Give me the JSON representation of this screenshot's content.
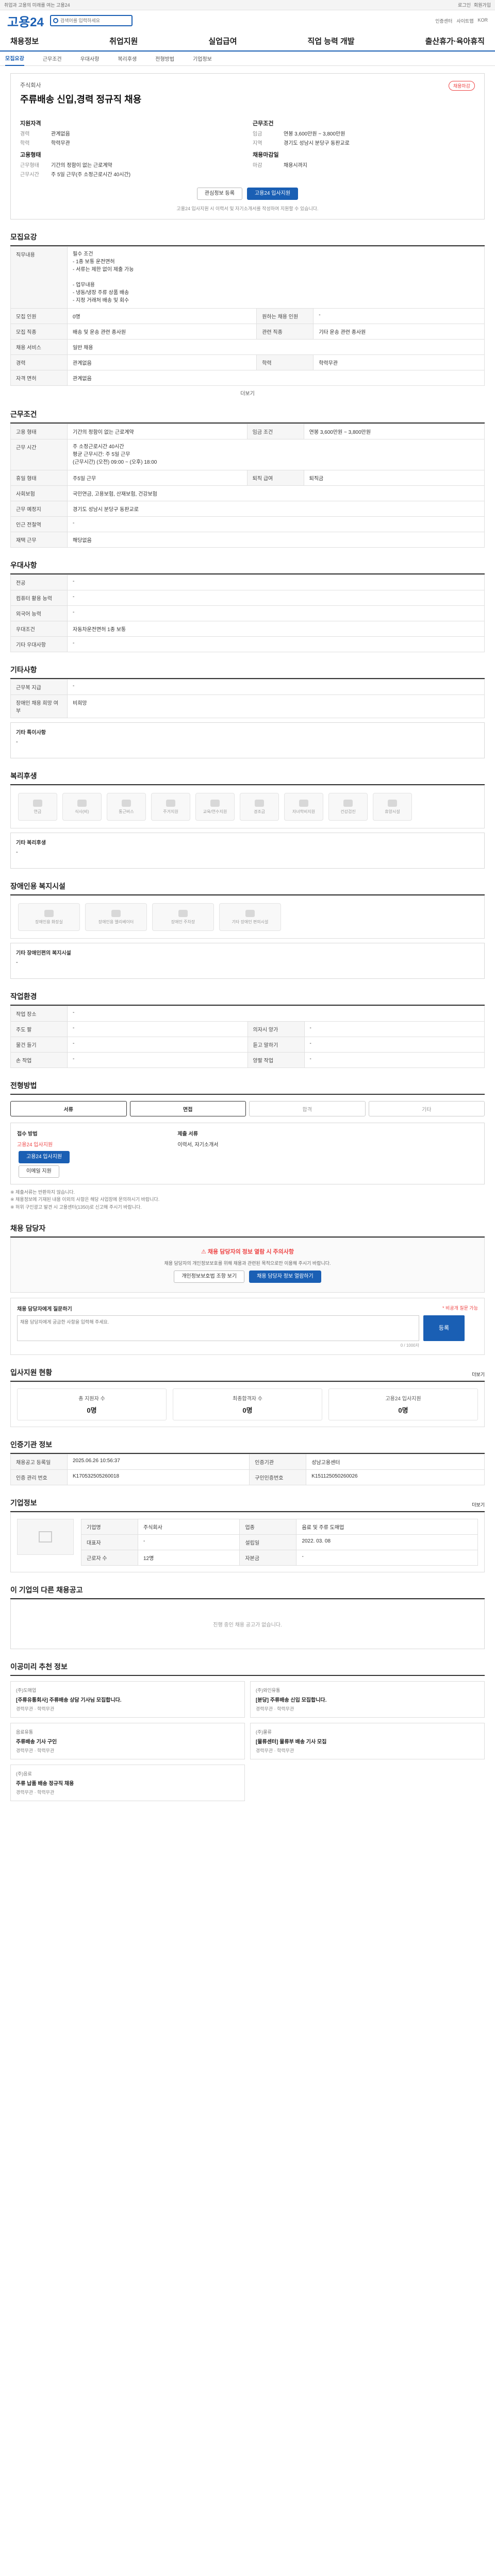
{
  "topbar": {
    "items": [
      "취업과 고용의 미래를 여는 고용24",
      "로그인",
      "회원가입"
    ]
  },
  "logo": {
    "text": "고용24"
  },
  "search": {
    "placeholder": "검색어를 입력하세요"
  },
  "logo_links": [
    "인증센터",
    "사이트맵",
    "KOR"
  ],
  "gnb": [
    "채용정보",
    "취업지원",
    "실업급여",
    "직업 능력 개발",
    "출산휴가·육아휴직"
  ],
  "subnav": [
    "모집요강",
    "근무조건",
    "우대사항",
    "복리후생",
    "전형방법",
    "기업정보"
  ],
  "job": {
    "badge": "채용마감",
    "company": "주식회사",
    "title": "주류배송 신입,경력 정규직 채용",
    "left_title": "지원자격",
    "left": [
      {
        "k": "경력",
        "v": "관계없음"
      },
      {
        "k": "학력",
        "v": "학력무관"
      }
    ],
    "left2_title": "고용형태",
    "left2": [
      {
        "k": "근무형태",
        "v": "기간의 정함이 없는 근로계약"
      },
      {
        "k": "근무시간",
        "v": "주 5일 근무(주 소정근로시간 40시간)"
      }
    ],
    "right_title": "근무조건",
    "right": [
      {
        "k": "임금",
        "v": "연봉 3,600만원 ~ 3,800만원"
      },
      {
        "k": "지역",
        "v": "경기도 성남시 분당구 동판교로"
      }
    ],
    "right2_title": "채용마감일",
    "right2": [
      {
        "k": "마감",
        "v": "채용시까지"
      }
    ],
    "btn_scrap": "관심정보 등록",
    "btn_apply": "고용24 입사지원",
    "note": "고용24 입사지원 시 이력서 및 자기소개서를 작성하여 지원할 수 있습니다."
  },
  "recruit": {
    "title": "모집요강",
    "duty_label": "직무내용",
    "duty": "필수 조건\n- 1종 보통 운전면허\n- 서류는 제한 없이 제출 가능\n\n- 업무내용\n- 냉동/냉장 주류 상품 배송\n- 지정 거래처 배송 및 회수",
    "more": "더보기",
    "rows": [
      {
        "k": "모집 인원",
        "v": "0명",
        "k2": "원하는 채용 인원",
        "v2": "-"
      },
      {
        "k": "모집 직종",
        "v": "배송 및 운송 관련 종사원",
        "k2": "관련 직종",
        "v2": "기타 운송 관련 종사원"
      },
      {
        "k": "채용 서비스",
        "v": "일반 채용",
        "k2": "",
        "v2": ""
      },
      {
        "k": "경력",
        "v": "관계없음",
        "k2": "학력",
        "v2": "학력무관"
      },
      {
        "k": "자격 면허",
        "v": "관계없음",
        "k2": "",
        "v2": ""
      }
    ]
  },
  "cond": {
    "title": "근무조건",
    "rows": [
      {
        "k": "고용 형태",
        "v": "기간의 정함이 없는 근로계약",
        "k2": "임금 조건",
        "v2": "연봉 3,600만원 ~ 3,800만원"
      },
      {
        "k": "근무 시간",
        "v": "주 소정근로시간 40시간\n평균 근무시간: 주 5일 근무\n(근무시간) (오전) 09:00 ~ (오후) 18:00",
        "k2": "",
        "v2": ""
      },
      {
        "k": "휴일 형태",
        "v": "주5일 근무",
        "k2": "퇴직 급여",
        "v2": "퇴직금"
      },
      {
        "k": "사회보험",
        "v": "국민연금, 고용보험, 산재보험, 건강보험",
        "k2": "",
        "v2": ""
      },
      {
        "k": "근무 예정지",
        "v": "경기도 성남시 분당구 동판교로",
        "k2": "",
        "v2": ""
      },
      {
        "k": "인근 전철역",
        "v": "-",
        "k2": "",
        "v2": ""
      },
      {
        "k": "재택 근무",
        "v": "해당없음",
        "k2": "",
        "v2": ""
      }
    ]
  },
  "pref": {
    "title": "우대사항",
    "rows": [
      {
        "k": "전공",
        "v": "-"
      },
      {
        "k": "컴퓨터 활용 능력",
        "v": "-"
      },
      {
        "k": "외국어 능력",
        "v": "-"
      },
      {
        "k": "우대조건",
        "v": "자동차운전면허 1종 보통"
      },
      {
        "k": "기타 우대사항",
        "v": "-"
      }
    ]
  },
  "etc": {
    "title": "기타사항",
    "rows": [
      {
        "k": "근무복 지급",
        "v": "-"
      },
      {
        "k": "장애인 채용 희망 여부",
        "v": "비희망"
      }
    ],
    "memo_label": "기타 특이사항",
    "memo": "-"
  },
  "welfare": {
    "title": "복리후생",
    "items": [
      "연금",
      "식사(비)",
      "통근버스",
      "주거지원",
      "교육/연수지원",
      "경조금",
      "자녀학비지원",
      "건강검진",
      "휴양시설"
    ],
    "memo_label": "기타 복리후생",
    "memo": "-"
  },
  "disabled": {
    "title": "장애인용 복지시설",
    "items": [
      "장애인용 화장실",
      "장애인용 엘리베이터",
      "장애인 주차장",
      "기타 장애인 편의시설"
    ],
    "memo_label": "기타 장애인편의 복지시설",
    "memo": "-"
  },
  "env": {
    "title": "작업환경",
    "rows": [
      {
        "k": "작업 장소",
        "v": "-",
        "k2": "",
        "v2": ""
      },
      {
        "k": "주도 팔",
        "v": "-",
        "k2": "의자시 양가",
        "v2": "-"
      },
      {
        "k": "물건 들기",
        "v": "-",
        "k2": "듣고 말하기",
        "v2": "-"
      },
      {
        "k": "손 작업",
        "v": "-",
        "k2": "양팔 작업",
        "v2": "-"
      }
    ]
  },
  "process": {
    "title": "전형방법",
    "steps": [
      "서류",
      "면접",
      "합격",
      "기타"
    ],
    "method_label": "접수 방법",
    "method": "고용24 입사지원",
    "docs_label": "제출 서류",
    "docs": "이력서, 자기소개서",
    "btn_apply": "고용24 입사지원",
    "btn_email": "이메일 지원",
    "notes": [
      "※ 제출서류는 반환하지 않습니다.",
      "※ 채용정보에 기재된 내용 이외의 사항은 해당 사업장에 문의하시기 바랍니다.",
      "※ 허위 구인광고 발견 시 고용센터(1350)로 신고해 주시기 바랍니다."
    ]
  },
  "contact": {
    "title": "채용 담당자",
    "notice_title": "채용 담당자의 정보 열람 시 주의사항",
    "notice": "채용 담당자의 개인정보보호를 위해 채용과 관련된 목적으로만 이용해 주시기 바랍니다.",
    "btn1": "개인정보보호법 조항 보기",
    "btn2": "채용 담당자 정보 열람하기",
    "comment_title": "채용 담당자에게 질문하기",
    "comment_meta": "* 비공개 질문 가능",
    "comment_placeholder": "채용 담당자에게 궁금한 사항을 입력해 주세요.",
    "comment_btn": "등록",
    "comment_count": "0 / 1000자"
  },
  "applicants": {
    "title": "입사지원 현황",
    "more": "더보기",
    "stats": [
      {
        "t": "총 지원자 수",
        "v": "0명"
      },
      {
        "t": "최종합격자 수",
        "v": "0명"
      },
      {
        "t": "고용24 입사지원",
        "v": "0명"
      }
    ]
  },
  "posting": {
    "title": "인증기관 정보",
    "rows": [
      {
        "k": "채용공고 등록일",
        "v": "2025.06.26 10:56:37",
        "k2": "인증기관",
        "v2": "성남고용센터"
      },
      {
        "k": "인증 관리 번호",
        "v": "K170532505260018",
        "k2": "구인인증번호",
        "v2": "K151125050260026"
      }
    ]
  },
  "company": {
    "title": "기업정보",
    "more": "더보기",
    "rows": [
      {
        "k": "기업명",
        "v": "주식회사",
        "k2": "업종",
        "v2": "음료 및 주류 도매업"
      },
      {
        "k": "대표자",
        "v": "-",
        "k2": "설립일",
        "v2": "2022. 03. 08"
      },
      {
        "k": "근로자 수",
        "v": "12명",
        "k2": "자본금",
        "v2": "-"
      }
    ]
  },
  "recommend": {
    "title": "이 기업의 다른 채용공고",
    "empty": "진행 중인 채용 공고가 없습니다."
  },
  "ai": {
    "title": "이공미리 추천 정보",
    "items": [
      {
        "c": "(주)도매업",
        "t": "[주류유통회사] 주류배송 상담 기사님 모집합니다.",
        "m": "경력무관 · 학력무관"
      },
      {
        "c": "(주)와인유통",
        "t": "[분당] 주류배송 신입 모집합니다.",
        "m": "경력무관 · 학력무관"
      },
      {
        "c": "음료유통",
        "t": "주류배송 기사 구인",
        "m": "경력무관 · 학력무관"
      },
      {
        "c": "(주)물류",
        "t": "[물류센터] 물류부 배송 기사 모집",
        "m": "경력무관 · 학력무관"
      },
      {
        "c": "(주)음료",
        "t": "주류 납품 배송 정규직 채용",
        "m": "경력무관 · 학력무관"
      }
    ]
  }
}
